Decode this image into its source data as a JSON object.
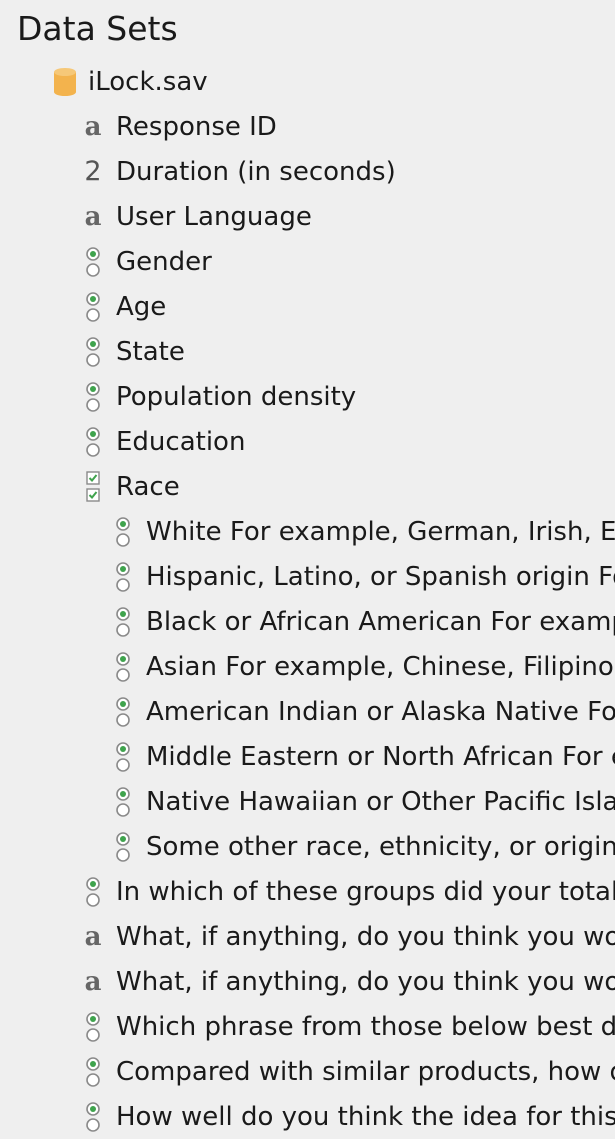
{
  "title": "Data Sets",
  "dataset": {
    "name": "iLock.sav",
    "icon": "database-cylinder-icon"
  },
  "variables": [
    {
      "label": "Response ID",
      "icon": "string-type-icon",
      "level": 1
    },
    {
      "label": "Duration (in seconds)",
      "icon": "numeric-type-icon",
      "level": 1
    },
    {
      "label": "User Language",
      "icon": "string-type-icon",
      "level": 1
    },
    {
      "label": "Gender",
      "icon": "single-choice-icon",
      "level": 1
    },
    {
      "label": "Age",
      "icon": "single-choice-icon",
      "level": 1
    },
    {
      "label": "State",
      "icon": "single-choice-icon",
      "level": 1
    },
    {
      "label": "Population density",
      "icon": "single-choice-icon",
      "level": 1
    },
    {
      "label": "Education",
      "icon": "single-choice-icon",
      "level": 1
    },
    {
      "label": "Race",
      "icon": "multi-choice-icon",
      "level": 1
    },
    {
      "label": "White For example, German, Irish, Er",
      "icon": "single-choice-icon",
      "level": 2
    },
    {
      "label": "Hispanic, Latino, or Spanish origin Fo",
      "icon": "single-choice-icon",
      "level": 2
    },
    {
      "label": "Black or African American For examp",
      "icon": "single-choice-icon",
      "level": 2
    },
    {
      "label": "Asian For example, Chinese, Filipino,",
      "icon": "single-choice-icon",
      "level": 2
    },
    {
      "label": "American Indian or Alaska Native For",
      "icon": "single-choice-icon",
      "level": 2
    },
    {
      "label": "Middle Eastern or North African For e",
      "icon": "single-choice-icon",
      "level": 2
    },
    {
      "label": "Native Hawaiian or Other Pacific Islan",
      "icon": "single-choice-icon",
      "level": 2
    },
    {
      "label": "Some other race, ethnicity, or origin",
      "icon": "single-choice-icon",
      "level": 2
    },
    {
      "label": "In which of these groups did your total",
      "icon": "single-choice-icon",
      "level": 1
    },
    {
      "label": "What, if anything, do you think you wou",
      "icon": "string-type-icon",
      "level": 1
    },
    {
      "label": "What, if anything, do you think you wou",
      "icon": "string-type-icon",
      "level": 1
    },
    {
      "label": "Which phrase from those below best de",
      "icon": "single-choice-icon",
      "level": 1
    },
    {
      "label": "Compared with similar products, how d",
      "icon": "single-choice-icon",
      "level": 1
    },
    {
      "label": "How well do you think the idea for this",
      "icon": "single-choice-icon",
      "level": 1
    }
  ]
}
